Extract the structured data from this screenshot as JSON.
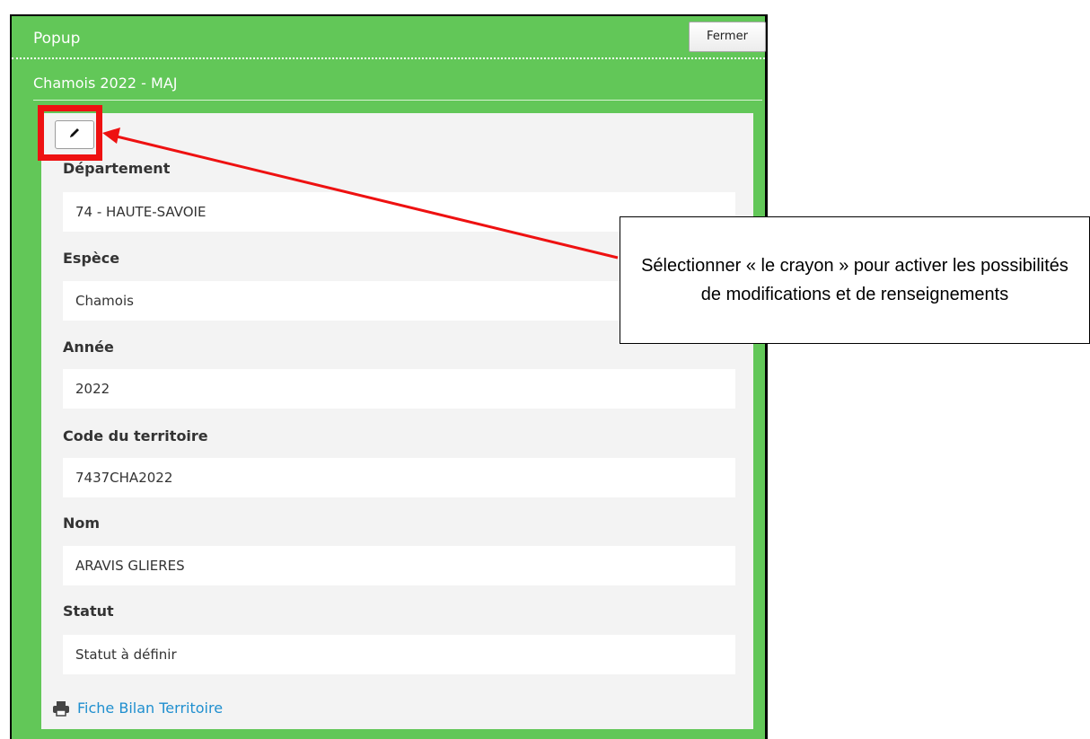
{
  "popup": {
    "title": "Popup",
    "close_label": "Fermer",
    "layer_title": "Chamois 2022 - MAJ"
  },
  "fields": [
    {
      "label": "Département",
      "value": "74 - HAUTE-SAVOIE"
    },
    {
      "label": "Espèce",
      "value": "Chamois"
    },
    {
      "label": "Année",
      "value": "2022"
    },
    {
      "label": "Code du territoire",
      "value": "7437CHA2022"
    },
    {
      "label": "Nom",
      "value": "ARAVIS GLIERES"
    },
    {
      "label": "Statut",
      "value": "Statut à définir"
    }
  ],
  "print_link": {
    "label": "Fiche Bilan Territoire",
    "icon": "printer-icon"
  },
  "edit_button": {
    "icon": "pencil-icon"
  },
  "annotation": {
    "callout_text": "Sélectionner « le crayon » pour activer les possibilités de modifications et de renseignements",
    "highlight_color": "#ee1111"
  },
  "colors": {
    "popup_green": "#62c758",
    "panel_bg": "#f3f3f3",
    "link_blue": "#1f8fcf"
  }
}
